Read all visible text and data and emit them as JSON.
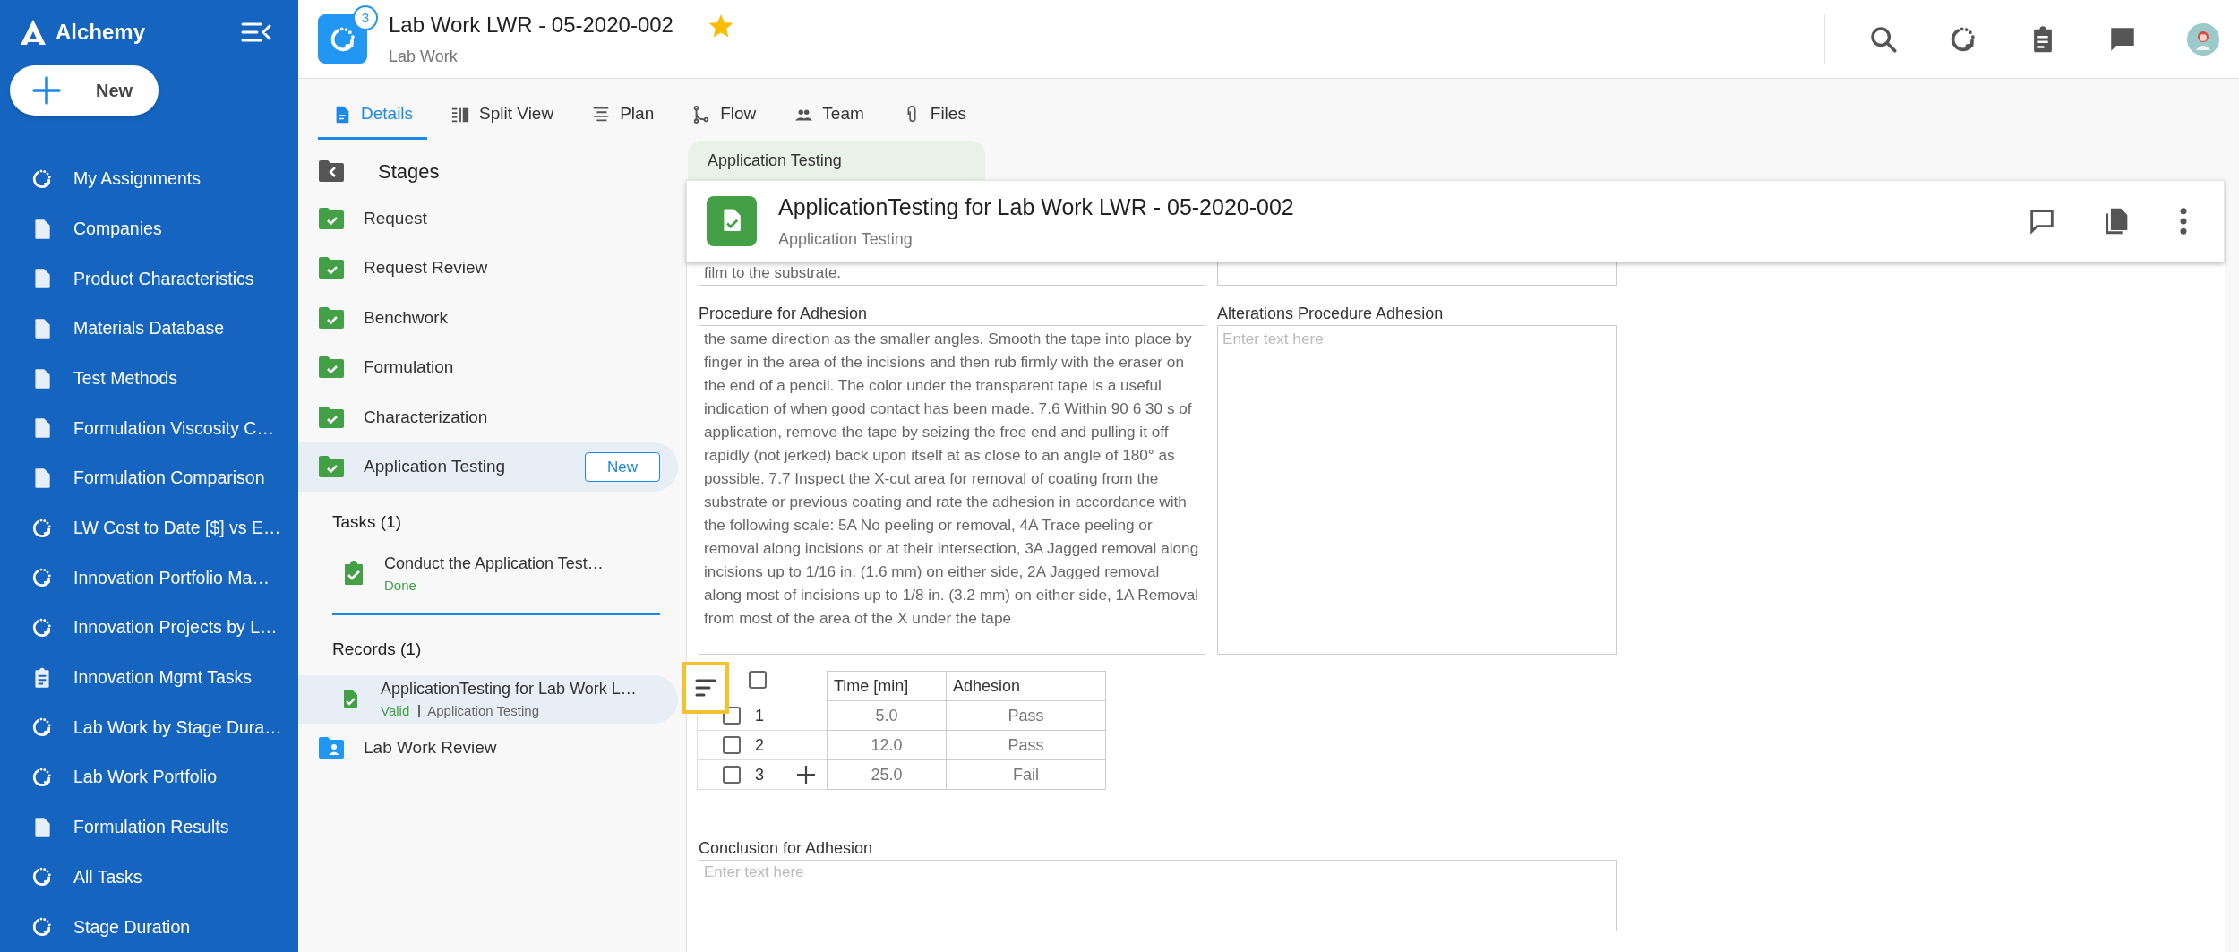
{
  "sidebar": {
    "brand": "Alchemy",
    "new_button": "New",
    "items": [
      {
        "label": "My Assignments",
        "kind": "cycle"
      },
      {
        "label": "Companies",
        "kind": "doc"
      },
      {
        "label": "Product Characteristics",
        "kind": "doc"
      },
      {
        "label": "Materials Database",
        "kind": "doc"
      },
      {
        "label": "Test Methods",
        "kind": "doc"
      },
      {
        "label": "Formulation Viscosity C…",
        "kind": "doc"
      },
      {
        "label": "Formulation Comparison",
        "kind": "doc"
      },
      {
        "label": "LW Cost to Date [$] vs E…",
        "kind": "cycle"
      },
      {
        "label": "Innovation Portfolio Ma…",
        "kind": "cycle"
      },
      {
        "label": "Innovation Projects by L…",
        "kind": "cycle"
      },
      {
        "label": "Innovation Mgmt Tasks",
        "kind": "clipboard"
      },
      {
        "label": "Lab Work by Stage Dura…",
        "kind": "cycle"
      },
      {
        "label": "Lab Work Portfolio",
        "kind": "cycle"
      },
      {
        "label": "Formulation Results",
        "kind": "doc"
      },
      {
        "label": "All Tasks",
        "kind": "cycle"
      },
      {
        "label": "Stage Duration",
        "kind": "cycle"
      }
    ]
  },
  "header": {
    "badge": "3",
    "title": "Lab Work LWR - 05-2020-002",
    "subtitle": "Lab Work",
    "starred": true
  },
  "tabs": [
    {
      "label": "Details",
      "selected": true
    },
    {
      "label": "Split View",
      "selected": false
    },
    {
      "label": "Plan",
      "selected": false
    },
    {
      "label": "Flow",
      "selected": false
    },
    {
      "label": "Team",
      "selected": false
    },
    {
      "label": "Files",
      "selected": false
    }
  ],
  "stages": {
    "title": "Stages",
    "items": [
      {
        "label": "Request",
        "kind": "done",
        "selected": false
      },
      {
        "label": "Request Review",
        "kind": "done",
        "selected": false
      },
      {
        "label": "Benchwork",
        "kind": "done",
        "selected": false
      },
      {
        "label": "Formulation",
        "kind": "done",
        "selected": false
      },
      {
        "label": "Characterization",
        "kind": "done",
        "selected": false
      },
      {
        "label": "Application Testing",
        "kind": "done",
        "selected": true,
        "button": "New",
        "tasks": {
          "heading": "Tasks (1)",
          "items": [
            {
              "title": "Conduct the Application Test…",
              "status": "Done"
            }
          ]
        },
        "records": {
          "heading": "Records (1)",
          "items": [
            {
              "title": "ApplicationTesting for Lab Work L…",
              "status": "Valid",
              "type": "Application Testing",
              "selected": true
            }
          ]
        }
      },
      {
        "label": "Lab Work Review",
        "kind": "review",
        "selected": false
      }
    ]
  },
  "record_tab": "Application Testing",
  "record": {
    "title": "ApplicationTesting for Lab Work LWR - 05-2020-002",
    "subtitle": "Application Testing"
  },
  "cut_off_field": {
    "value": "film to the substrate."
  },
  "fields": [
    {
      "label": "Procedure for Adhesion",
      "value": "the same direction as the smaller angles. Smooth the tape into place by finger in the area of the incisions and then rub firmly with the eraser on the end of a pencil. The color under the transparent tape is a useful indication of when good contact has been made. 7.6 Within 90 6 30 s of application, remove the tape by seizing the free end and pulling it off rapidly (not jerked) back upon itself at as close to an angle of 180° as possible. 7.7 Inspect the X-cut area for removal of coating from the substrate or previous coating and rate the adhesion in accordance with the following scale: 5A No peeling or removal, 4A Trace peeling or removal along incisions or at their intersection, 3A Jagged removal along incisions up to 1/16 in. (1.6 mm) on either side, 2A Jagged removal along most of incisions up to 1/8 in. (3.2 mm) on either side, 1A Removal from most of the area of the X under the tape"
    },
    {
      "label": "Alterations Procedure Adhesion",
      "placeholder": "Enter text here"
    }
  ],
  "table": {
    "all_checked": false,
    "columns": [
      "Time [min]",
      "Adhesion"
    ],
    "rows": [
      {
        "number": "1",
        "checked": false,
        "cells": [
          "5.0",
          "Pass"
        ]
      },
      {
        "number": "2",
        "checked": false,
        "cells": [
          "12.0",
          "Pass"
        ]
      },
      {
        "number": "3",
        "checked": false,
        "cells": [
          "25.0",
          "Fail"
        ]
      }
    ]
  },
  "conclusion": {
    "label": "Conclusion for Adhesion",
    "placeholder": "Enter text here"
  }
}
